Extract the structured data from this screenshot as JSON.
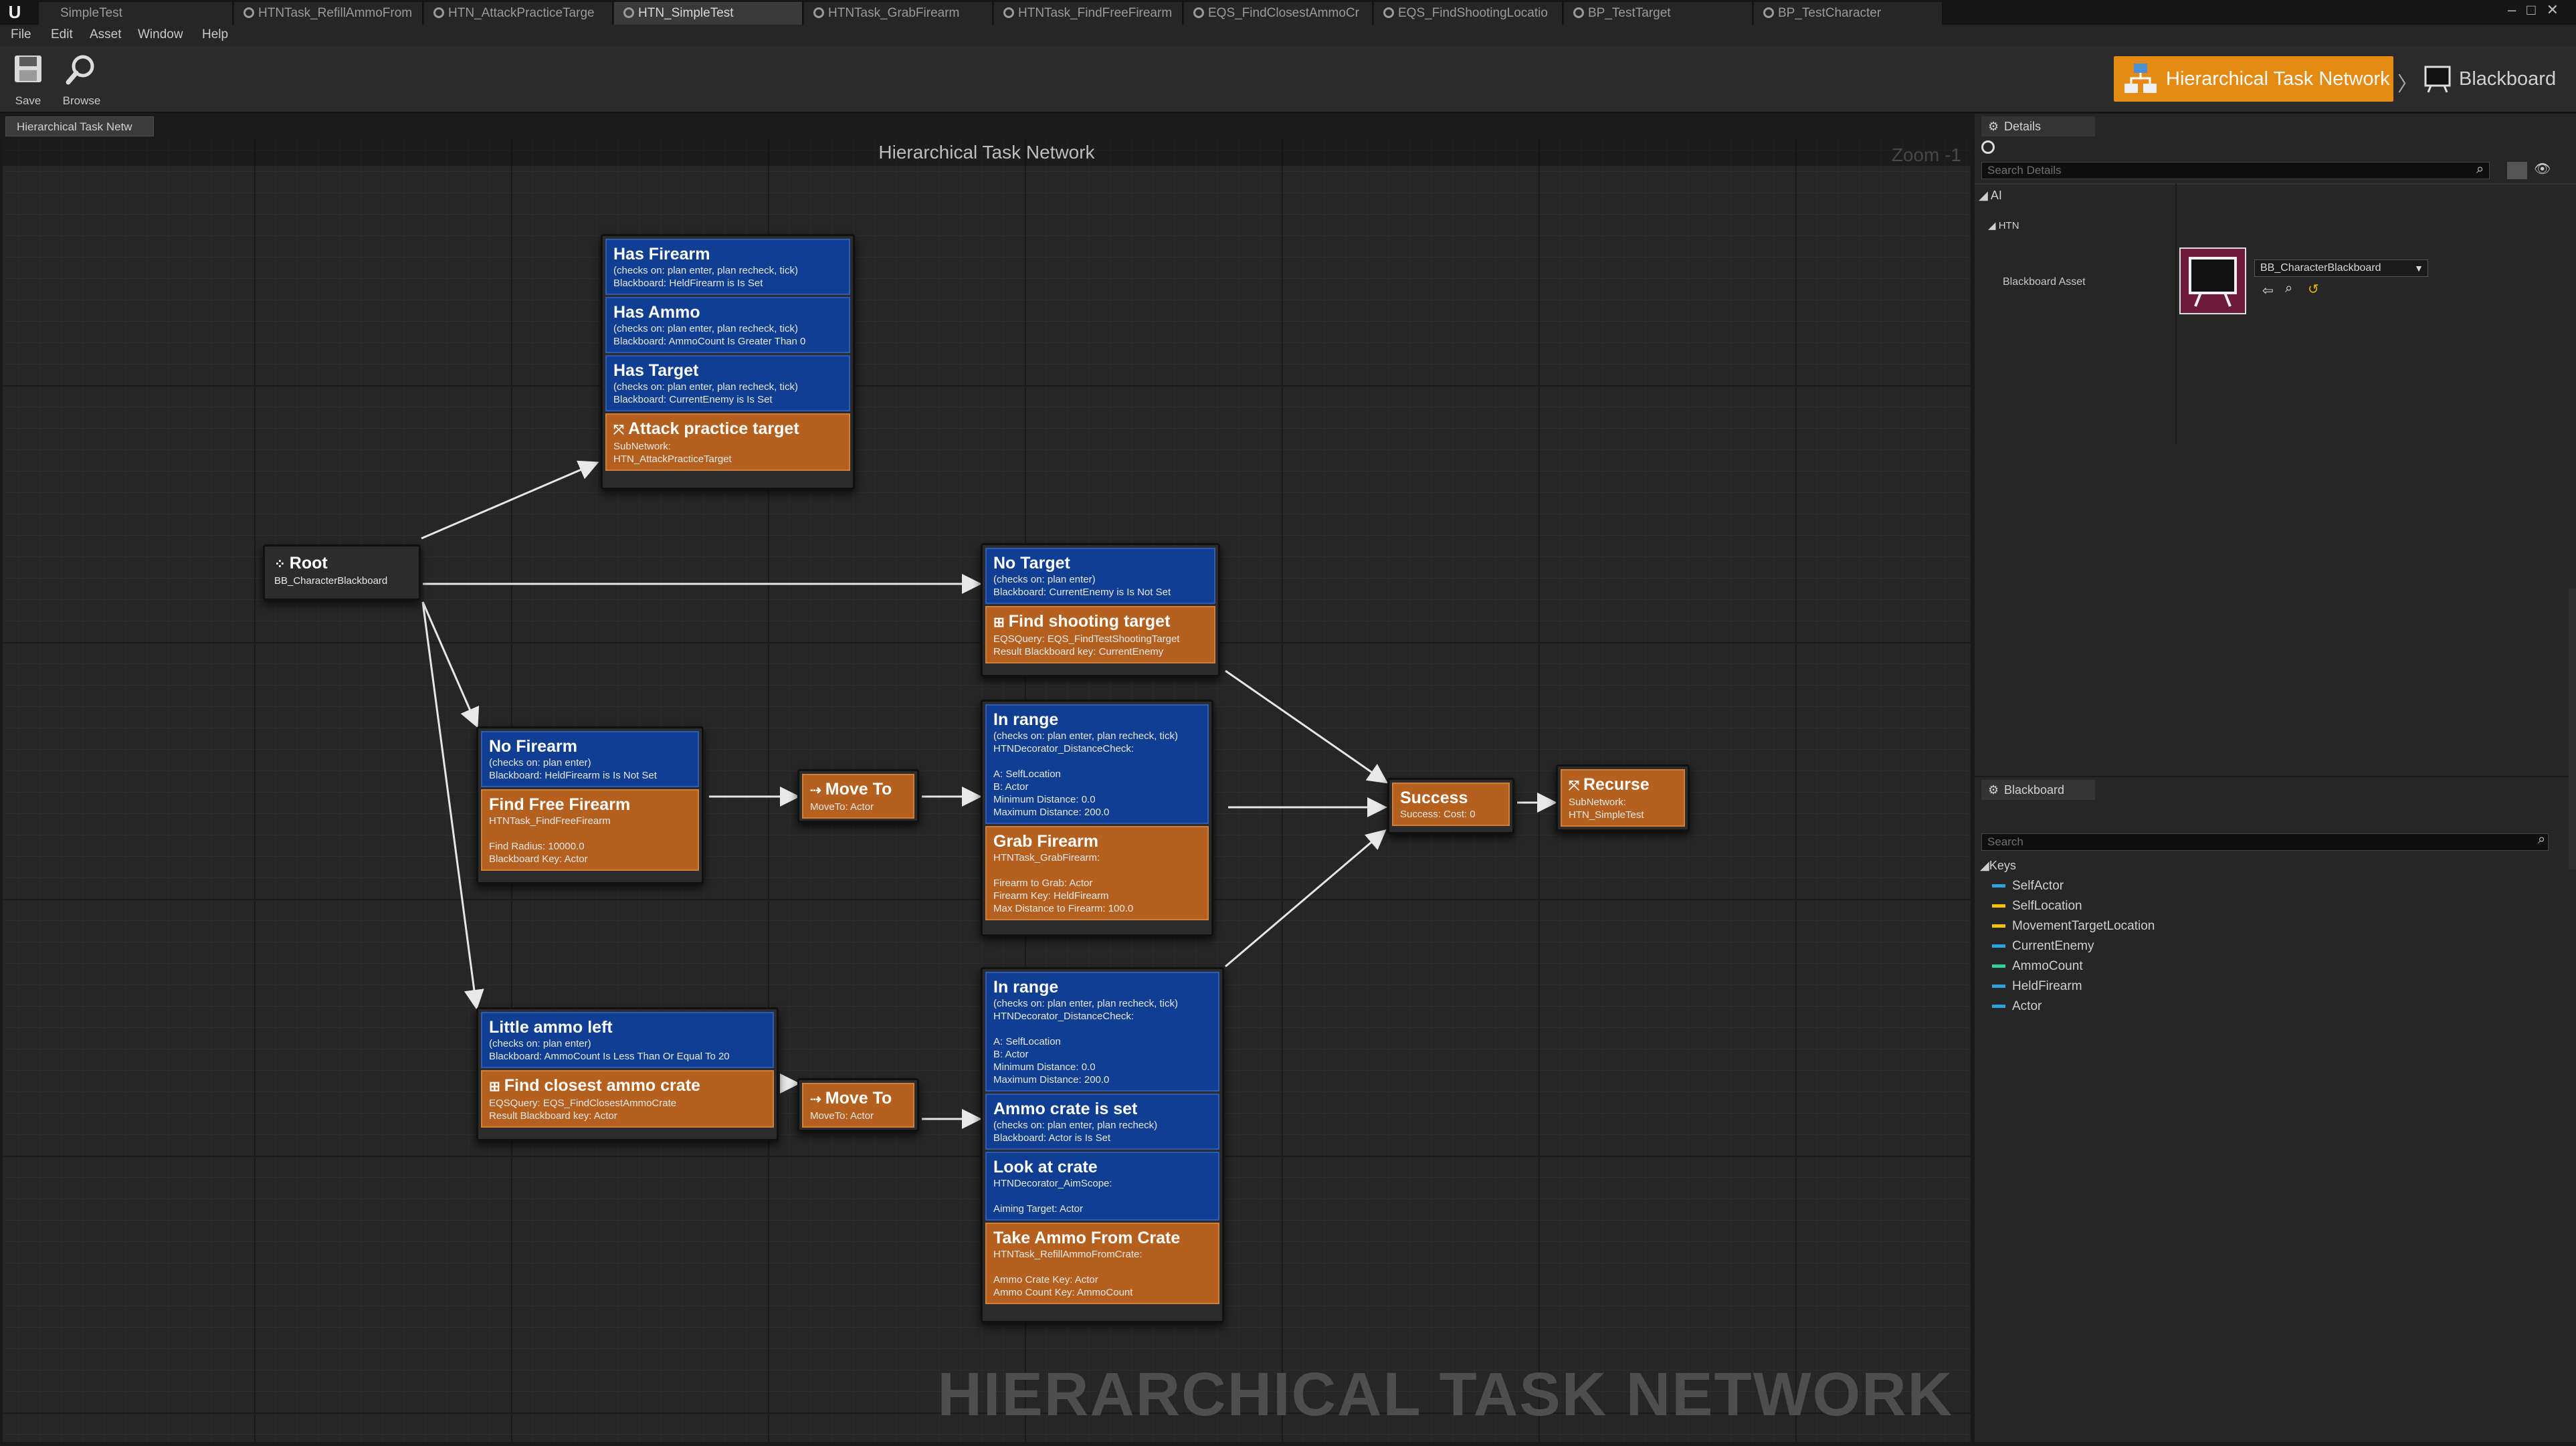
{
  "titlebar": {
    "tabs": [
      {
        "label": "SimpleTest",
        "active": false
      },
      {
        "label": "HTNTask_RefillAmmoFrom",
        "active": false
      },
      {
        "label": "HTN_AttackPracticeTarge",
        "active": false
      },
      {
        "label": "HTN_SimpleTest",
        "active": true
      },
      {
        "label": "HTNTask_GrabFirearm",
        "active": false
      },
      {
        "label": "HTNTask_FindFreeFirearm",
        "active": false
      },
      {
        "label": "EQS_FindClosestAmmoCr",
        "active": false
      },
      {
        "label": "EQS_FindShootingLocatio",
        "active": false
      },
      {
        "label": "BP_TestTarget",
        "active": false
      },
      {
        "label": "BP_TestCharacter",
        "active": false
      }
    ]
  },
  "menu": [
    "File",
    "Edit",
    "Asset",
    "Window",
    "Help"
  ],
  "toolbar": {
    "save_label": "Save",
    "browse_label": "Browse"
  },
  "modes": {
    "htn_label": "Hierarchical Task Network",
    "blackboard_label": "Blackboard"
  },
  "graph": {
    "tab_label": "Hierarchical Task Netw",
    "title": "Hierarchical Task Network",
    "zoom": "Zoom -1",
    "watermark": "HIERARCHICAL TASK NETWORK",
    "nodes": {
      "root": {
        "title": "Root",
        "sub": "BB_CharacterBlackboard"
      },
      "n1": {
        "has_firearm": {
          "title": "Has Firearm",
          "sub": "(checks on: plan enter, plan recheck, tick)\nBlackboard: HeldFirearm is Is Set"
        },
        "has_ammo": {
          "title": "Has Ammo",
          "sub": "(checks on: plan enter, plan recheck, tick)\nBlackboard: AmmoCount Is Greater Than 0"
        },
        "has_target": {
          "title": "Has Target",
          "sub": "(checks on: plan enter, plan recheck, tick)\nBlackboard: CurrentEnemy is Is Set"
        },
        "attack": {
          "title": "Attack practice target",
          "sub": "SubNetwork:\nHTN_AttackPracticeTarget"
        }
      },
      "n2": {
        "no_target": {
          "title": "No Target",
          "sub": "(checks on: plan enter)\nBlackboard: CurrentEnemy is Is Not Set"
        },
        "find_shooting": {
          "title": "Find shooting target",
          "sub": "EQSQuery: EQS_FindTestShootingTarget\nResult Blackboard key: CurrentEnemy"
        }
      },
      "n3": {
        "no_firearm": {
          "title": "No Firearm",
          "sub": "(checks on: plan enter)\nBlackboard: HeldFirearm is Is Not Set"
        },
        "find_free": {
          "title": "Find Free Firearm",
          "sub": "HTNTask_FindFreeFirearm\n\nFind Radius: 10000.0\nBlackboard Key: Actor"
        }
      },
      "n4": {
        "title": "Move To",
        "sub": "MoveTo: Actor"
      },
      "n5": {
        "in_range": {
          "title": "In range",
          "sub": "(checks on: plan enter, plan recheck, tick)\nHTNDecorator_DistanceCheck:\n\nA: SelfLocation\nB: Actor\nMinimum Distance: 0.0\nMaximum Distance: 200.0"
        },
        "grab": {
          "title": "Grab Firearm",
          "sub": "HTNTask_GrabFirearm:\n\nFirearm to Grab: Actor\nFirearm Key: HeldFirearm\nMax Distance to Firearm: 100.0"
        }
      },
      "success": {
        "title": "Success",
        "sub": "Success: Cost: 0"
      },
      "recurse": {
        "title": "Recurse",
        "sub": "SubNetwork:\nHTN_SimpleTest"
      },
      "n6": {
        "little_ammo": {
          "title": "Little ammo left",
          "sub": "(checks on: plan enter)\nBlackboard: AmmoCount Is Less Than Or Equal To 20"
        },
        "find_crate": {
          "title": "Find closest ammo crate",
          "sub": "EQSQuery: EQS_FindClosestAmmoCrate\nResult Blackboard key: Actor"
        }
      },
      "n7": {
        "title": "Move To",
        "sub": "MoveTo: Actor"
      },
      "n8": {
        "in_range": {
          "title": "In range",
          "sub": "(checks on: plan enter, plan recheck, tick)\nHTNDecorator_DistanceCheck:\n\nA: SelfLocation\nB: Actor\nMinimum Distance: 0.0\nMaximum Distance: 200.0"
        },
        "crate_set": {
          "title": "Ammo crate is set",
          "sub": "(checks on: plan enter, plan recheck)\nBlackboard: Actor is Is Set"
        },
        "look": {
          "title": "Look at crate",
          "sub": "HTNDecorator_AimScope:\n\nAiming Target: Actor"
        },
        "take": {
          "title": "Take Ammo From Crate",
          "sub": "HTNTask_RefillAmmoFromCrate:\n\nAmmo Crate Key: Actor\nAmmo Count Key: AmmoCount"
        }
      }
    }
  },
  "details": {
    "tab_label": "Details",
    "search_placeholder": "Search Details",
    "category_ai": "AI",
    "category_htn": "HTN",
    "blackboard_asset_label": "Blackboard Asset",
    "blackboard_asset_value": "BB_CharacterBlackboard"
  },
  "blackboard": {
    "tab_label": "Blackboard",
    "search_placeholder": "Search",
    "keys_label": "Keys",
    "keys": [
      {
        "name": "SelfActor",
        "color": "#2aa3e0"
      },
      {
        "name": "SelfLocation",
        "color": "#f5c200"
      },
      {
        "name": "MovementTargetLocation",
        "color": "#f5c200"
      },
      {
        "name": "CurrentEnemy",
        "color": "#2aa3e0"
      },
      {
        "name": "AmmoCount",
        "color": "#2fd19a"
      },
      {
        "name": "HeldFirearm",
        "color": "#2aa3e0"
      },
      {
        "name": "Actor",
        "color": "#2aa3e0"
      }
    ]
  },
  "colors": {
    "accent": "#e58a12",
    "decorator_blue": "#0f3e92",
    "task_orange": "#b5601e"
  }
}
